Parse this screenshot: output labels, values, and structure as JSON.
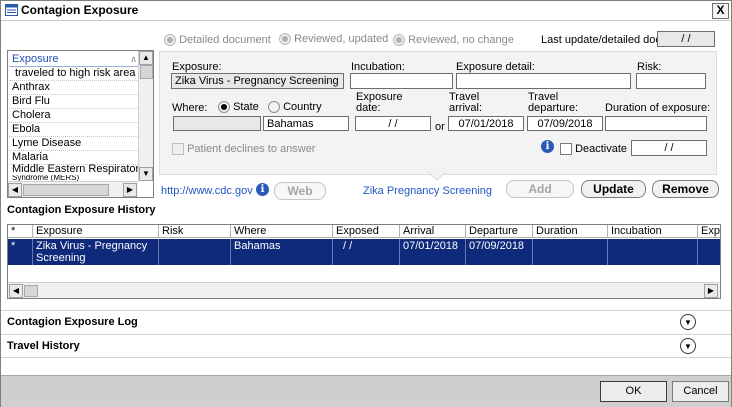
{
  "window": {
    "title": "Contagion Exposure",
    "close_label": "X"
  },
  "options": {
    "detailed_document": "Detailed document",
    "reviewed_updated": "Reviewed, updated",
    "reviewed_no_change": "Reviewed, no change",
    "last_update_label": "Last update/detailed doc",
    "last_update_value": "/ /"
  },
  "exposure_list": {
    "header": "Exposure",
    "items": [
      "traveled to high risk area",
      "Anthrax",
      "Bird Flu",
      "Cholera",
      "Ebola",
      "Lyme Disease",
      "Malaria",
      "Middle Eastern Respiratory",
      "Syndrome (MERS)"
    ]
  },
  "form": {
    "exposure_label": "Exposure:",
    "exposure_value": "Zika Virus - Pregnancy Screening",
    "incubation_label": "Incubation:",
    "incubation_value": "",
    "exposure_detail_label": "Exposure detail:",
    "exposure_detail_value": "",
    "risk_label": "Risk:",
    "risk_value": "",
    "where_label": "Where:",
    "state_label": "State",
    "country_label": "Country",
    "state_value": "",
    "country_value": "Bahamas",
    "exposure_date_label_1": "Exposure",
    "exposure_date_label_2": "date:",
    "exposure_date_value": "/ /",
    "or_label": "or",
    "travel_arrival_label_1": "Travel",
    "travel_arrival_label_2": "arrival:",
    "travel_arrival_value": "07/01/2018",
    "travel_departure_label_1": "Travel",
    "travel_departure_label_2": "departure:",
    "travel_departure_value": "07/09/2018",
    "duration_label": "Duration of exposure:",
    "duration_value": "",
    "declines_label": "Patient declines to answer",
    "deactivate_label": "Deactivate",
    "deactivate_date": "/ /"
  },
  "links": {
    "cdc_url": "http://www.cdc.gov",
    "web_label": "Web",
    "zika_link": "Zika Pregnancy Screening"
  },
  "actions": {
    "add": "Add",
    "update": "Update",
    "remove": "Remove"
  },
  "history": {
    "title": "Contagion Exposure History",
    "columns": [
      "*",
      "Exposure",
      "Risk",
      "Where",
      "Exposed",
      "Arrival",
      "Departure",
      "Duration",
      "Incubation",
      "Expo"
    ],
    "rows": [
      {
        "star": "*",
        "exposure_1": "Zika Virus - Pregnancy",
        "exposure_2": "Screening",
        "risk": "",
        "where": "Bahamas",
        "exposed": "/ /",
        "arrival": "07/01/2018",
        "departure": "07/09/2018",
        "duration": "",
        "incubation": "",
        "expo": ""
      }
    ]
  },
  "sections": {
    "log": "Contagion Exposure Log",
    "travel": "Travel History"
  },
  "footer": {
    "ok": "OK",
    "cancel": "Cancel"
  },
  "colors": {
    "selection": "#0f2a7a",
    "link": "#2255c4",
    "footer": "#cfcfcf"
  }
}
